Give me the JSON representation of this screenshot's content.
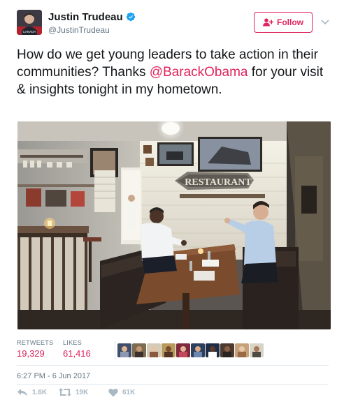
{
  "author": {
    "name": "Justin Trudeau",
    "handle": "@JustinTrudeau",
    "verified": true,
    "avatar_badge": "CANADA"
  },
  "follow_button": {
    "label": "Follow",
    "icon": "add-user-icon"
  },
  "tweet": {
    "text_before": "How do we get young leaders to take action in their communities? Thanks ",
    "mention": "@BarackObama",
    "text_after": " for your visit & insights tonight in my hometown."
  },
  "photo": {
    "sign_text": "RESTAURANT"
  },
  "stats": {
    "retweets_label": "RETWEETS",
    "retweets_value": "19,329",
    "likes_label": "LIKES",
    "likes_value": "61,416",
    "liker_avatar_count": 10
  },
  "timestamp": "6:27 PM - 6 Jun 2017",
  "actions": {
    "reply_count": "1.6K",
    "retweet_count": "19K",
    "like_count": "61K"
  },
  "colors": {
    "accent": "#e0245e",
    "muted": "#657786",
    "icon_muted": "#aab8c2",
    "verified_blue": "#1da1f2"
  }
}
